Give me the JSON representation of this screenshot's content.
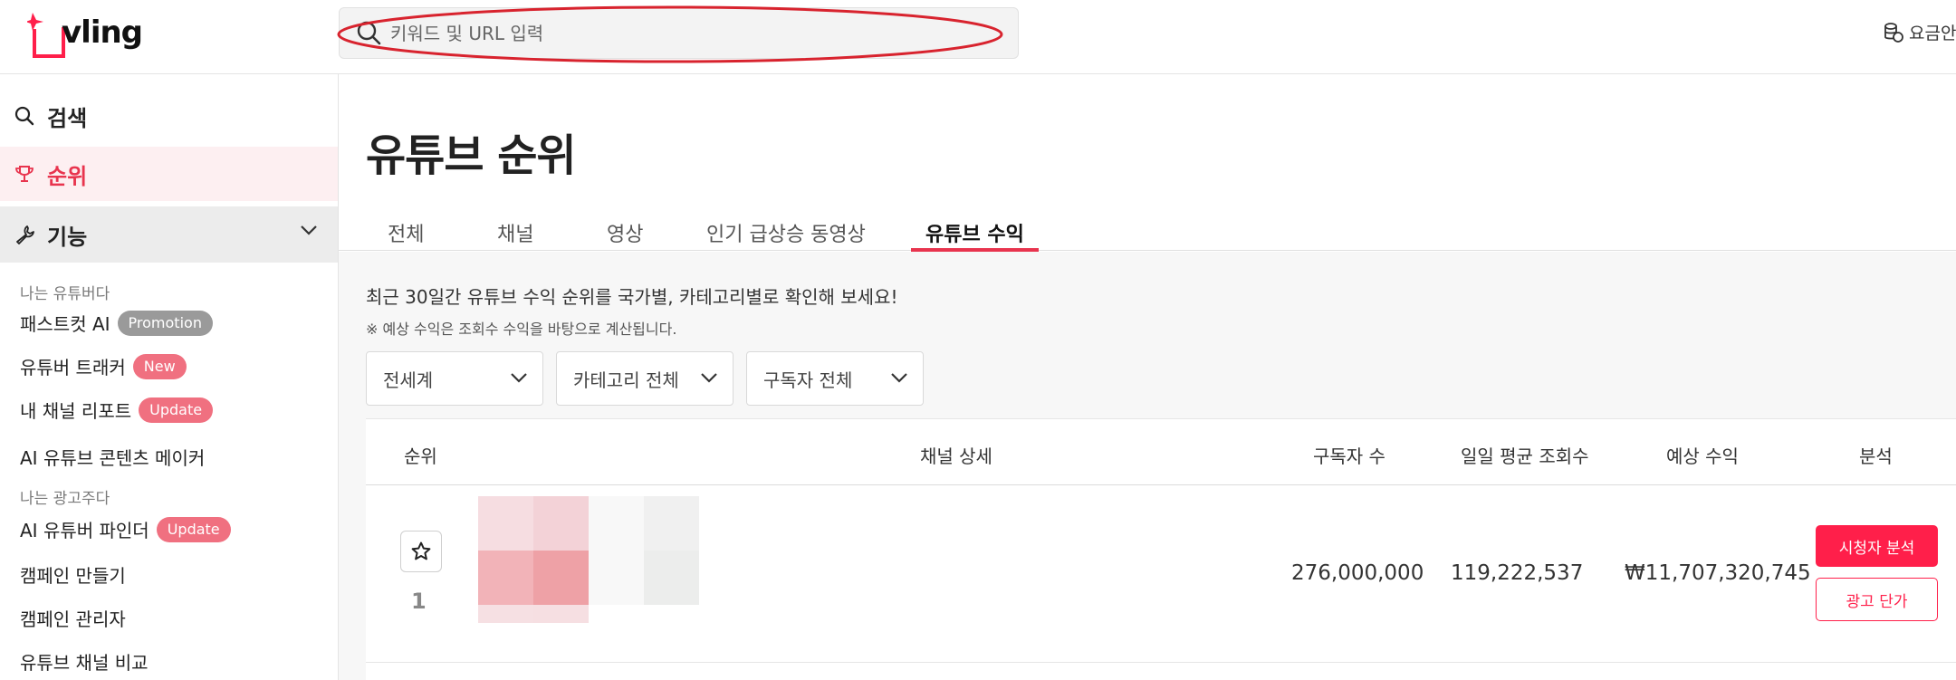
{
  "header": {
    "logo_text": "vling",
    "search_placeholder": "키워드 및 URL 입력",
    "pricing_label": "요금안"
  },
  "sidebar": {
    "search_label": "검색",
    "rank_label": "순위",
    "feature_label": "기능",
    "section_youtuber": "나는 유튜버다",
    "section_advertiser": "나는 광고주다",
    "items": [
      {
        "label": "패스트컷 AI",
        "badge": "Promotion"
      },
      {
        "label": "유튜버 트래커",
        "badge": "New"
      },
      {
        "label": "내 채널 리포트",
        "badge": "Update"
      },
      {
        "label": "AI 유튜브 콘텐츠 메이커",
        "badge": ""
      },
      {
        "label": "AI 유튜버 파인더",
        "badge": "Update"
      },
      {
        "label": "캠페인 만들기",
        "badge": ""
      },
      {
        "label": "캠페인 관리자",
        "badge": ""
      },
      {
        "label": "유튜브 채널 비교",
        "badge": ""
      }
    ]
  },
  "main": {
    "title": "유튜브 순위",
    "tabs": [
      "전체",
      "채널",
      "영상",
      "인기 급상승 동영상",
      "유튜브 수익"
    ],
    "active_tab": "유튜브 수익",
    "description": "최근 30일간 유튜브 수익 순위를 국가별, 카테고리별로 확인해 보세요!",
    "note": "※ 예상 수익은 조회수 수익을 바탕으로 계산됩니다.",
    "filters": [
      "전세계",
      "카테고리 전체",
      "구독자 전체"
    ]
  },
  "table": {
    "headers": [
      "순위",
      "채널 상세",
      "구독자 수",
      "일일 평균 조회수",
      "예상 수익",
      "분석"
    ],
    "rows": [
      {
        "rank": "1",
        "subscribers": "276,000,000",
        "daily_views": "119,222,537",
        "revenue": "₩11,707,320,745",
        "analyze_label": "시청자 분석",
        "ad_price_label": "광고 단가"
      }
    ]
  },
  "colors": {
    "accent": "#e8344e",
    "button": "#ff1f4a"
  }
}
